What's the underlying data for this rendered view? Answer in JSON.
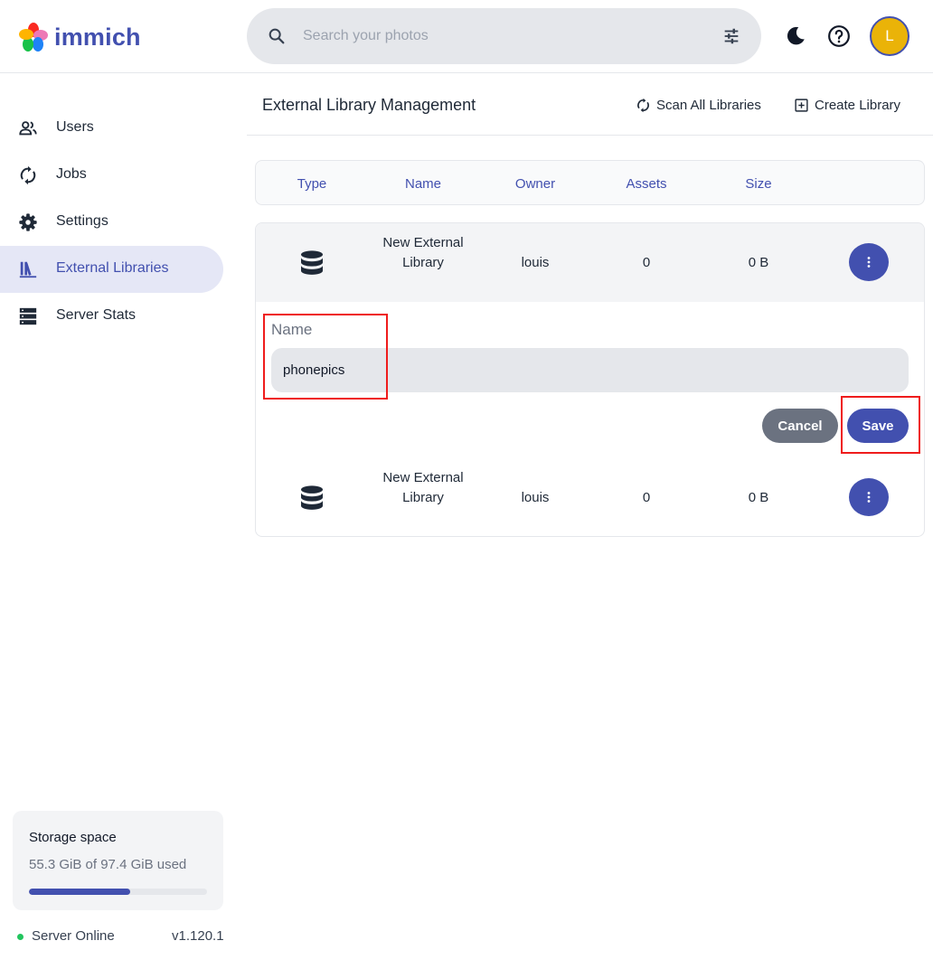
{
  "app": {
    "name": "immich"
  },
  "search": {
    "placeholder": "Search your photos"
  },
  "header": {
    "avatar_initial": "L"
  },
  "sidebar": {
    "items": [
      {
        "label": "Users",
        "icon": "account-multiple-icon",
        "active": false
      },
      {
        "label": "Jobs",
        "icon": "sync-icon",
        "active": false
      },
      {
        "label": "Settings",
        "icon": "cog-icon",
        "active": false
      },
      {
        "label": "External Libraries",
        "icon": "bookshelf-icon",
        "active": true
      },
      {
        "label": "Server Stats",
        "icon": "server-icon",
        "active": false
      }
    ],
    "storage": {
      "title": "Storage space",
      "used_text": "55.3 GiB of 97.4 GiB used",
      "used_fraction": 0.568
    },
    "server_status": "Server Online",
    "version": "v1.120.1"
  },
  "page": {
    "title": "External Library Management",
    "scan_all_label": "Scan All Libraries",
    "create_label": "Create Library"
  },
  "table": {
    "headers": [
      "Type",
      "Name",
      "Owner",
      "Assets",
      "Size"
    ],
    "rows": [
      {
        "name": "New External Library",
        "owner": "louis",
        "assets": "0",
        "size": "0 B"
      },
      {
        "name": "New External Library",
        "owner": "louis",
        "assets": "0",
        "size": "0 B"
      }
    ]
  },
  "rename_form": {
    "label": "Name",
    "value": "phonepics",
    "cancel_label": "Cancel",
    "save_label": "Save"
  },
  "colors": {
    "accent": "#4250af",
    "avatar": "#eab308",
    "online": "#22c55e",
    "highlight_box": "#ef1c1c"
  }
}
